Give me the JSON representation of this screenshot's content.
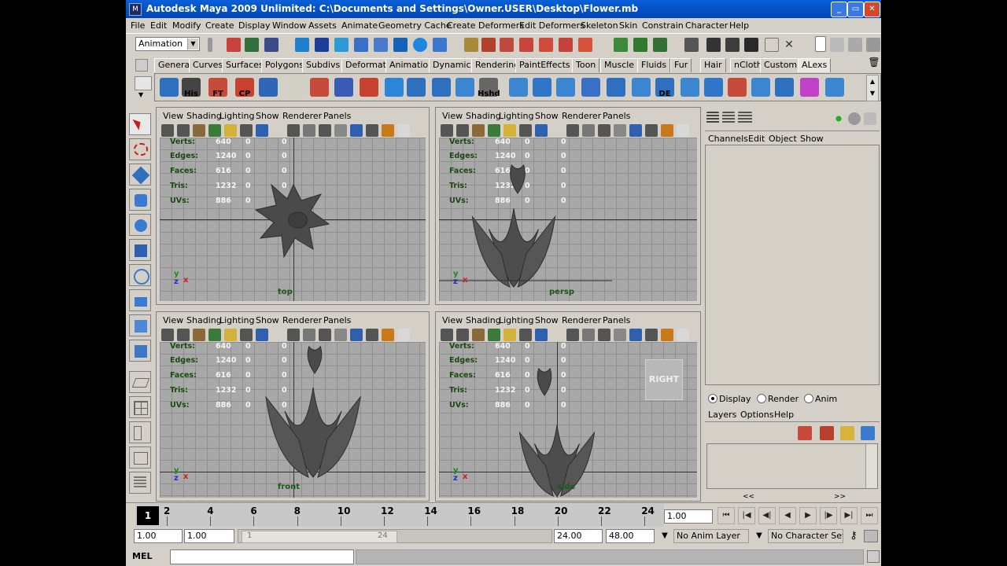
{
  "window": {
    "title": "Autodesk Maya 2009 Unlimited: C:\\Documents and Settings\\Owner.USER\\Desktop\\Flower.mb",
    "minimize": "_",
    "maximize": "▭",
    "close": "✕"
  },
  "menubar": [
    "File",
    "Edit",
    "Modify",
    "Create",
    "Display",
    "Window",
    "Assets",
    "Animate",
    "Geometry Cache",
    "Create Deformers",
    "Edit Deformers",
    "Skeleton",
    "Skin",
    "Constrain",
    "Character",
    "Help"
  ],
  "statusline": {
    "menu_set": "Animation"
  },
  "shelf": {
    "tabs": [
      "General",
      "Curves",
      "Surfaces",
      "Polygons",
      "Subdivs",
      "Deformation",
      "Animation",
      "Dynamics",
      "Rendering",
      "PaintEffects",
      "Toon",
      "Muscle",
      "Fluids",
      "Fur",
      "Hair",
      "nCloth",
      "Custom",
      "ALexs"
    ],
    "active_tab": "ALexs",
    "labeled_icons": [
      "His",
      "FT",
      "CP",
      "Hshd",
      "DE"
    ]
  },
  "viewport_menu": [
    "View",
    "Shading",
    "Lighting",
    "Show",
    "Renderer",
    "Panels"
  ],
  "stats_labels": [
    "Verts:",
    "Edges:",
    "Faces:",
    "Tris:",
    "UVs:"
  ],
  "viewports": [
    {
      "camera": "top",
      "stats": [
        [
          "640",
          "0",
          "0"
        ],
        [
          "1240",
          "0",
          "0"
        ],
        [
          "616",
          "0",
          "0"
        ],
        [
          "1232",
          "0",
          "0"
        ],
        [
          "886",
          "0",
          "0"
        ]
      ]
    },
    {
      "camera": "persp",
      "stats": [
        [
          "640",
          "0",
          "0"
        ],
        [
          "1240",
          "0",
          "0"
        ],
        [
          "616",
          "0",
          "0"
        ],
        [
          "1232",
          "0",
          "0"
        ],
        [
          "886",
          "0",
          "0"
        ]
      ]
    },
    {
      "camera": "front",
      "stats": [
        [
          "640",
          "0",
          "0"
        ],
        [
          "1240",
          "0",
          "0"
        ],
        [
          "616",
          "0",
          "0"
        ],
        [
          "1232",
          "0",
          "0"
        ],
        [
          "886",
          "0",
          "0"
        ]
      ]
    },
    {
      "camera": "side",
      "stats": [
        [
          "640",
          "0",
          "0"
        ],
        [
          "1240",
          "0",
          "0"
        ],
        [
          "616",
          "0",
          "0"
        ],
        [
          "1232",
          "0",
          "0"
        ],
        [
          "886",
          "0",
          "0"
        ]
      ],
      "view_cube": "RIGHT"
    }
  ],
  "channel_box": {
    "menu": [
      "Channels",
      "Edit",
      "Object",
      "Show"
    ]
  },
  "layer_editor": {
    "modes": [
      "Display",
      "Render",
      "Anim"
    ],
    "selected_mode": "Display",
    "menu": [
      "Layers",
      "Options",
      "Help"
    ],
    "scroll_left": "<<",
    "scroll_right": ">>"
  },
  "time_slider": {
    "ticks": [
      "2",
      "4",
      "6",
      "8",
      "10",
      "12",
      "14",
      "16",
      "18",
      "20",
      "22",
      "24"
    ],
    "current_frame": "1",
    "current_time_field": "1.00"
  },
  "range_slider": {
    "start_time": "1.00",
    "playback_start": "1.00",
    "slider_label": "1",
    "slider_end_label": "24",
    "playback_end": "24.00",
    "end_time": "48.00",
    "anim_layer": "No Anim Layer",
    "character_set": "No Character Set"
  },
  "command_line": {
    "label": "MEL",
    "value": ""
  },
  "colors": {
    "titlebar": "#0a5fd8",
    "ui_gray": "#d4d0c8",
    "viewport_bg": "#a8a8a8",
    "stats_label": "#1a4a10",
    "stats_value": "#f4f4f4"
  }
}
